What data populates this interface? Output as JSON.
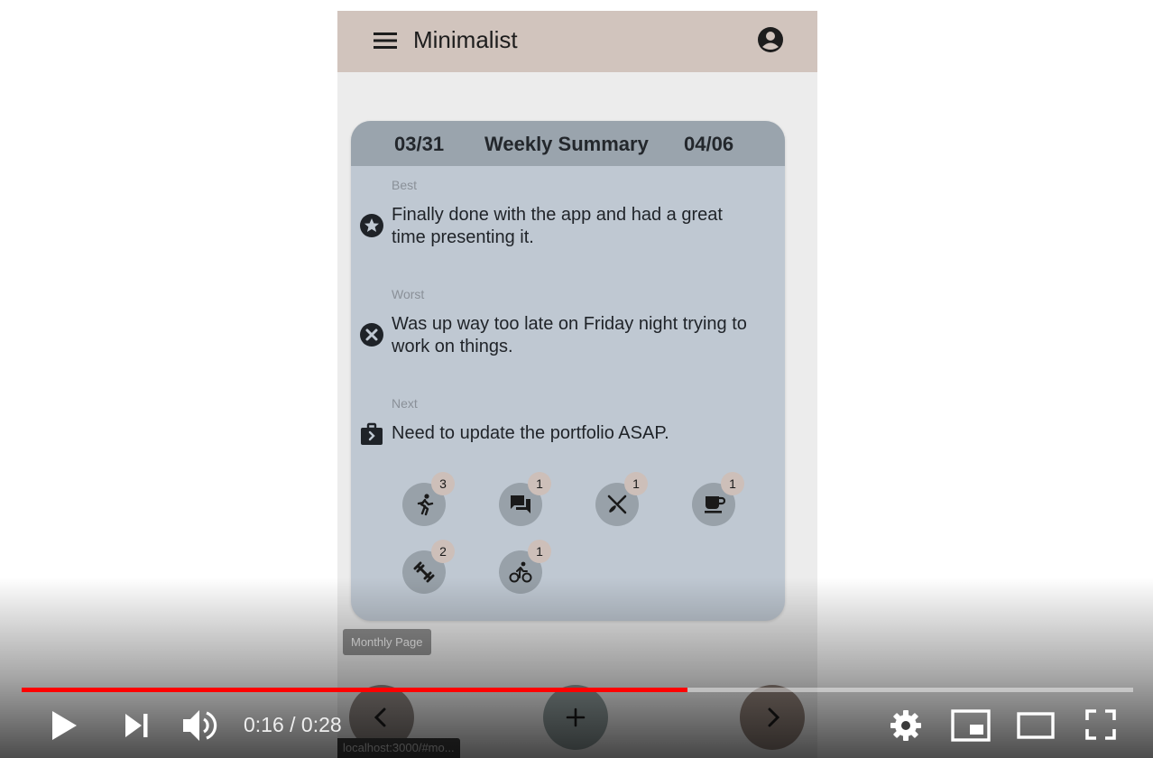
{
  "app": {
    "title": "Minimalist"
  },
  "summary": {
    "start_date": "03/31",
    "title": "Weekly Summary",
    "end_date": "04/06",
    "best_label": "Best",
    "best_text": "Finally done with the app and had a great time presenting it.",
    "worst_label": "Worst",
    "worst_text": "Was up way too late on Friday night trying to work on things.",
    "next_label": "Next",
    "next_text": "Need to update the portfolio ASAP."
  },
  "activities": [
    {
      "icon": "running-icon",
      "count": "3"
    },
    {
      "icon": "chat-icon",
      "count": "1"
    },
    {
      "icon": "dining-icon",
      "count": "1"
    },
    {
      "icon": "coffee-icon",
      "count": "1"
    },
    {
      "icon": "fitness-icon",
      "count": "2"
    },
    {
      "icon": "cycling-icon",
      "count": "1"
    }
  ],
  "tooltip": "Monthly Page",
  "status_url": "localhost:3000/#mo...",
  "player": {
    "current_time": "0:16",
    "duration": "0:28",
    "time_display": "0:16 / 0:28",
    "progress": 0.599
  },
  "colors": {
    "app_bar": "#d1c4bd",
    "card": "#bfc8d2",
    "card_header": "#9aa4ad",
    "progress": "#ff0000"
  }
}
